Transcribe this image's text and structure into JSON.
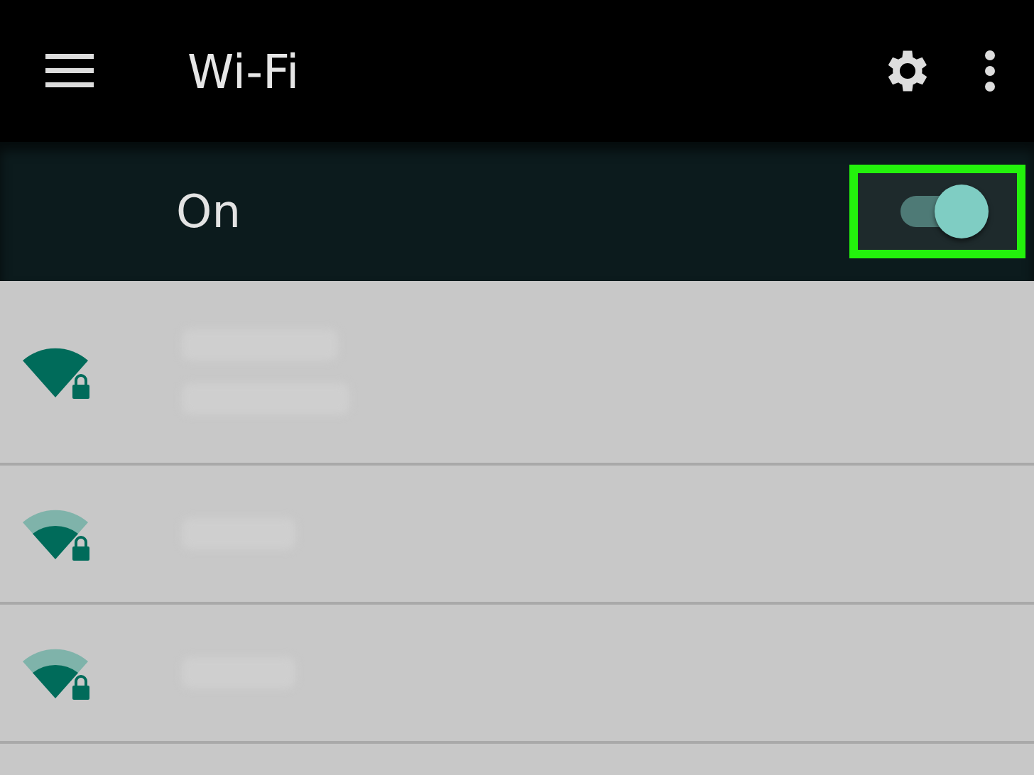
{
  "app_bar": {
    "title": "Wi-Fi"
  },
  "master_switch": {
    "label": "On",
    "on": true,
    "highlighted": true
  },
  "networks": [
    {
      "kind": "full",
      "locked": true,
      "detail_shown": true
    },
    {
      "kind": "partial",
      "locked": true,
      "detail_shown": false
    },
    {
      "kind": "partial",
      "locked": true,
      "detail_shown": false
    }
  ]
}
